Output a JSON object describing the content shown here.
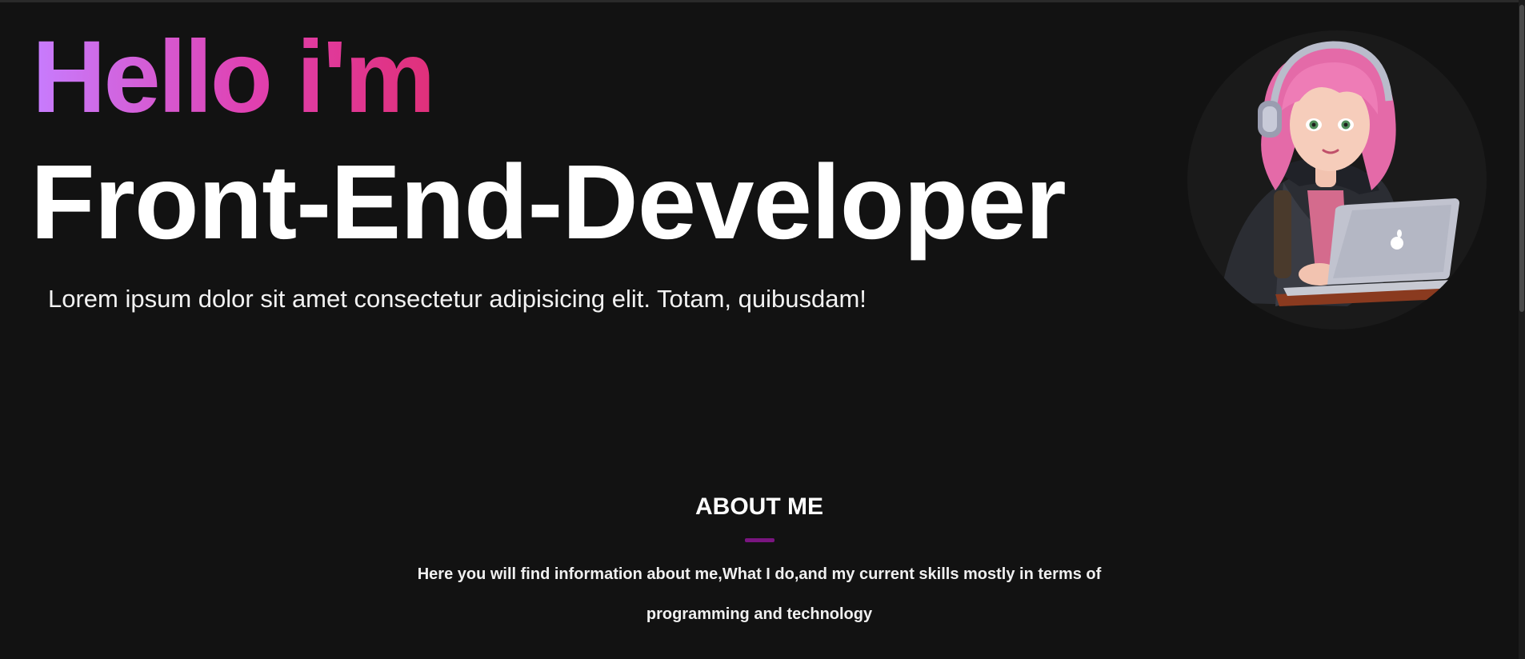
{
  "hero": {
    "greeting": "Hello i'm",
    "role": "Front-End-Developer",
    "description": "Lorem ipsum dolor sit amet consectetur adipisicing elit. Totam, quibusdam!",
    "avatar_icon": "developer-girl-with-headphones-and-laptop"
  },
  "about": {
    "title": "ABOUT ME",
    "text": "Here you will find information about me,What I do,and my current skills mostly in terms of programming and technology"
  },
  "colors": {
    "background": "#121212",
    "gradient_start": "#c77dff",
    "gradient_end": "#e0307a",
    "accent_underline": "#7a1580",
    "text": "#ffffff"
  }
}
